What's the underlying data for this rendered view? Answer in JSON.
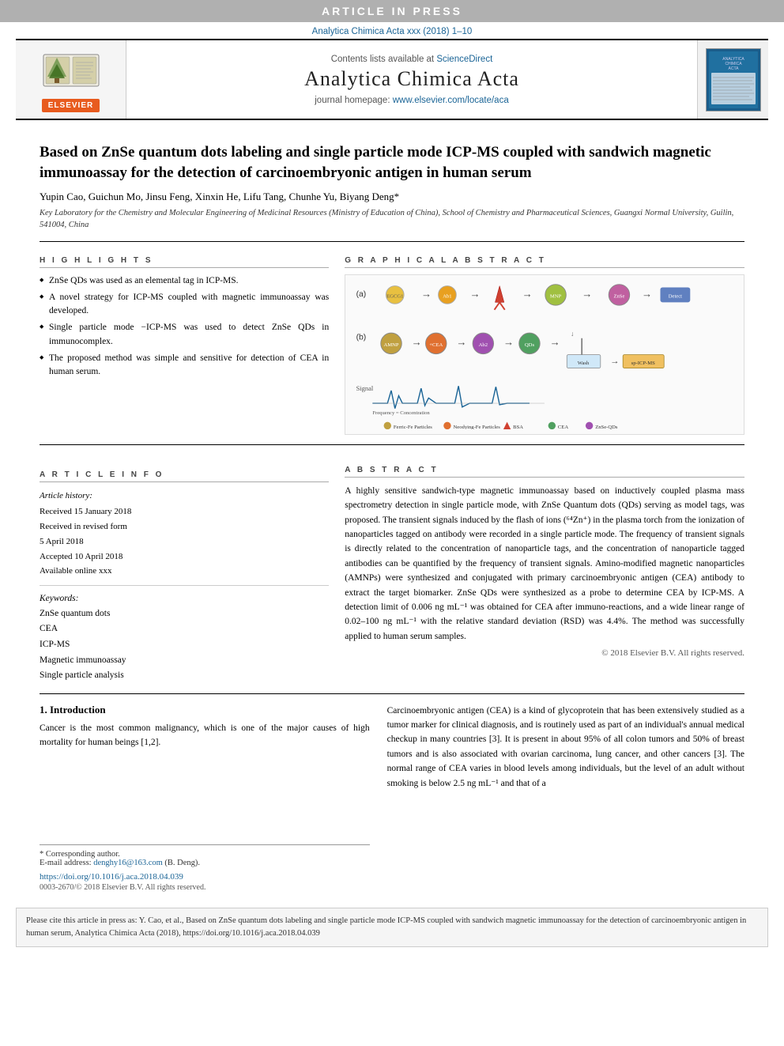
{
  "banner": {
    "text": "ARTICLE IN PRESS"
  },
  "journal_ref": {
    "text": "Analytica Chimica Acta xxx (2018) 1–10"
  },
  "header": {
    "contents_label": "Contents lists available at",
    "sciencedirect": "ScienceDirect",
    "journal_title": "Analytica Chimica Acta",
    "homepage_label": "journal homepage:",
    "homepage_url": "www.elsevier.com/locate/aca",
    "elsevier_label": "ELSEVIER",
    "thumb_alt": "Journal cover thumbnail"
  },
  "article": {
    "title": "Based on ZnSe quantum dots labeling and single particle mode ICP-MS coupled with sandwich magnetic immunoassay for the detection of carcinoembryonic antigen in human serum",
    "authors": "Yupin Cao, Guichun Mo, Jinsu Feng, Xinxin He, Lifu Tang, Chunhe Yu, Biyang Deng*",
    "affiliation": "Key Laboratory for the Chemistry and Molecular Engineering of Medicinal Resources (Ministry of Education of China), School of Chemistry and Pharmaceutical Sciences, Guangxi Normal University, Guilin, 541004, China",
    "highlights_label": "H I G H L I G H T S",
    "highlights": [
      "ZnSe QDs was used as an elemental tag in ICP-MS.",
      "A novel strategy for ICP-MS coupled with magnetic immunoassay was developed.",
      "Single particle mode −ICP-MS was used to detect ZnSe QDs in immunocomplex.",
      "The proposed method was simple and sensitive for detection of CEA in human serum."
    ],
    "graphical_abstract_label": "G R A P H I C A L   A B S T R A C T",
    "article_info_label": "A R T I C L E   I N F O",
    "article_history_label": "Article history:",
    "received_label": "Received 15 January 2018",
    "received_revised": "Received in revised form",
    "revised_date": "5 April 2018",
    "accepted": "Accepted 10 April 2018",
    "available": "Available online xxx",
    "keywords_label": "Keywords:",
    "keywords": [
      "ZnSe quantum dots",
      "CEA",
      "ICP-MS",
      "Magnetic immunoassay",
      "Single particle analysis"
    ],
    "abstract_label": "A B S T R A C T",
    "abstract": "A highly sensitive sandwich-type magnetic immunoassay based on inductively coupled plasma mass spectrometry detection in single particle mode, with ZnSe Quantum dots (QDs) serving as model tags, was proposed. The transient signals induced by the flash of ions (⁶⁴Zn⁺) in the plasma torch from the ionization of nanoparticles tagged on antibody were recorded in a single particle mode. The frequency of transient signals is directly related to the concentration of nanoparticle tags, and the concentration of nanoparticle tagged antibodies can be quantified by the frequency of transient signals. Amino-modified magnetic nanoparticles (AMNPs) were synthesized and conjugated with primary carcinoembryonic antigen (CEA) antibody to extract the target biomarker. ZnSe QDs were synthesized as a probe to determine CEA by ICP-MS. A detection limit of 0.006 ng mL⁻¹ was obtained for CEA after immuno-reactions, and a wide linear range of 0.02–100 ng mL⁻¹ with the relative standard deviation (RSD) was 4.4%. The method was successfully applied to human serum samples.",
    "copyright": "© 2018 Elsevier B.V. All rights reserved.",
    "intro_heading": "1.  Introduction",
    "intro_left": "Cancer is the most common malignancy, which is one of the major causes of high mortality for human beings [1,2].",
    "intro_right": "Carcinoembryonic antigen (CEA) is a kind of glycoprotein that has been extensively studied as a tumor marker for clinical diagnosis, and is routinely used as part of an individual's annual medical checkup in many countries [3]. It is present in about 95% of all colon tumors and 50% of breast tumors and is also associated with ovarian carcinoma, lung cancer, and other cancers [3]. The normal range of CEA varies in blood levels among individuals, but the level of an adult without smoking is below 2.5 ng mL⁻¹ and that of a",
    "footnote_star": "* Corresponding author.",
    "footnote_email_label": "E-mail address:",
    "footnote_email": "denghy16@163.com",
    "footnote_email_suffix": "(B. Deng).",
    "doi_url": "https://doi.org/10.1016/j.aca.2018.04.039",
    "issn": "0003-2670/© 2018 Elsevier B.V. All rights reserved.",
    "citation_note": "Please cite this article in press as: Y. Cao, et al., Based on ZnSe quantum dots labeling and single particle mode ICP-MS coupled with sandwich magnetic immunoassay for the detection of carcinoembryonic antigen in human serum, Analytica Chimica Acta (2018), https://doi.org/10.1016/j.aca.2018.04.039"
  }
}
